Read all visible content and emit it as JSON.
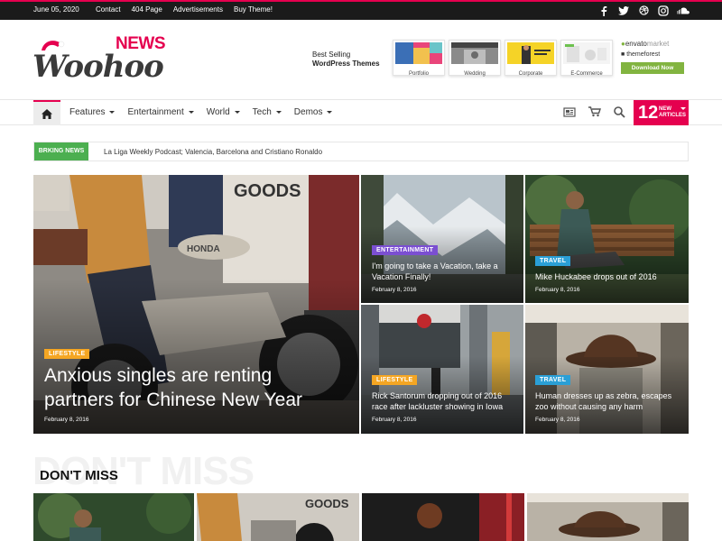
{
  "topbar": {
    "date": "June 05, 2020",
    "links": [
      "Contact",
      "404 Page",
      "Advertisements",
      "Buy Theme!"
    ],
    "socials": [
      "facebook-icon",
      "twitter-icon",
      "dribbble-icon",
      "instagram-icon",
      "soundcloud-icon"
    ]
  },
  "header": {
    "logo_news": "NEWS",
    "logo_woohoo": "Woohoo",
    "best_selling_1": "Best Selling",
    "best_selling_2": "WordPress Themes",
    "demos": [
      "Portfolio",
      "Wedding",
      "Corporate",
      "E-Commerce"
    ],
    "envato": "envato",
    "envato_market": "market",
    "themeforest": "themeforest",
    "download": "Download Now"
  },
  "nav": {
    "items": [
      "Features",
      "Entertainment",
      "World",
      "Tech",
      "Demos"
    ],
    "new_count": "12",
    "new_label_1": "NEW",
    "new_label_2": "ARTICLES"
  },
  "breaking": {
    "label": "BRKING NEWS",
    "text": "La Liga Weekly Podcast; Valencia, Barcelona and Cristiano Ronaldo"
  },
  "grid": {
    "main": {
      "category": "LIFESTYLE",
      "title_1": "Anxious singles are renting",
      "title_2": "partners for Chinese New Year",
      "date": "February 8, 2016"
    },
    "top_mid": {
      "category": "ENTERTAINMENT",
      "title_1": "I'm going to take a Vacation, take a",
      "title_2": "Vacation Finally!",
      "date": "February 8, 2016"
    },
    "top_right": {
      "category": "TRAVEL",
      "title_1": "Mike Huckabee drops out of 2016",
      "date": "February 8, 2016"
    },
    "bot_mid": {
      "category": "LIFESTYLE",
      "title_1": "Rick Santorum dropping out of 2016",
      "title_2": "race after lackluster showing in Iowa",
      "date": "February 8, 2016"
    },
    "bot_right": {
      "category": "TRAVEL",
      "title_1": "Human dresses up as zebra, escapes",
      "title_2": "zoo without causing any harm",
      "date": "February 8, 2016"
    }
  },
  "dont_miss": {
    "bg": "DON'T MISS",
    "title": "DON'T MISS"
  },
  "colors": {
    "accent": "#e5004f",
    "green": "#4caf50",
    "purple": "#7b4fd1",
    "orange": "#f5a623",
    "blue": "#2a9fd6"
  }
}
